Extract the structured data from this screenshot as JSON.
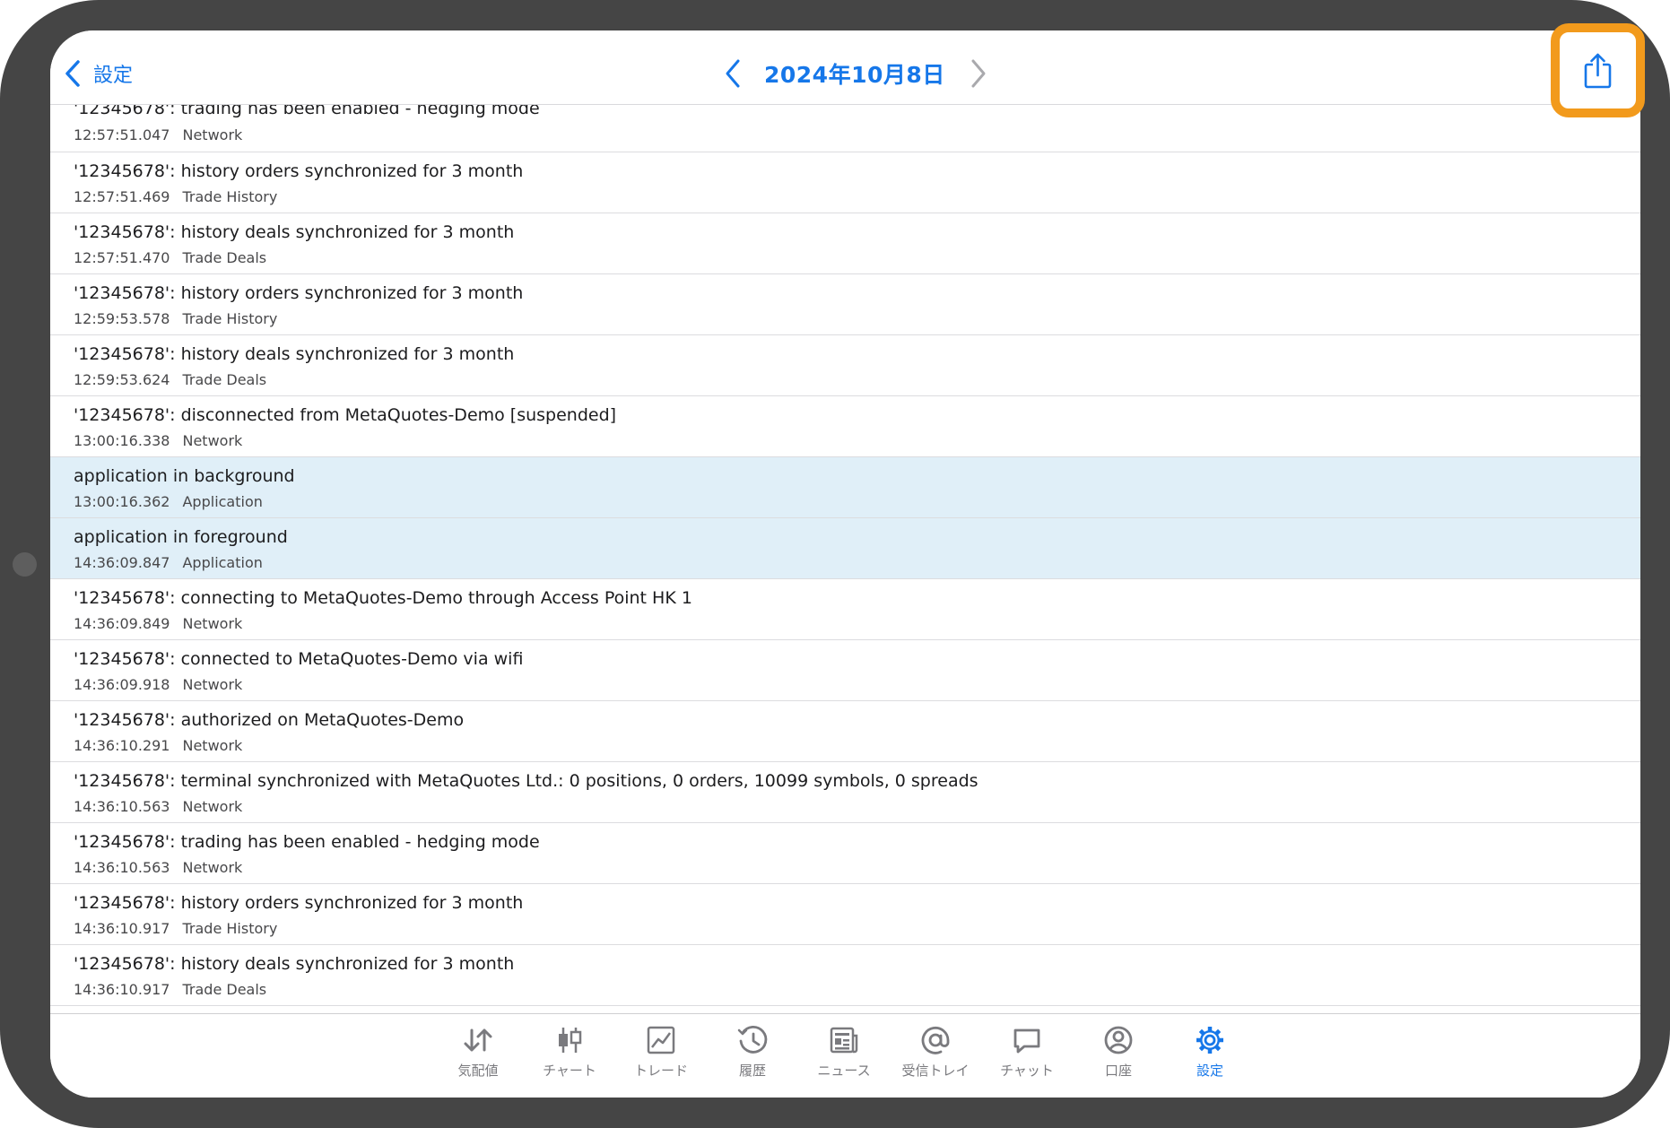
{
  "nav": {
    "back_label": "設定",
    "date_title": "2024年10月8日"
  },
  "colors": {
    "accent": "#1677e9",
    "highlight_box": "#f29a1c",
    "selected_row_bg": "#e0eff8",
    "device_frame": "#454545"
  },
  "logs": [
    {
      "msg": "'12345678': trading has been enabled - hedging mode",
      "time": "12:57:51.047",
      "category": "Network"
    },
    {
      "msg": "'12345678': history orders synchronized for 3 month",
      "time": "12:57:51.469",
      "category": "Trade History"
    },
    {
      "msg": "'12345678': history deals synchronized for 3 month",
      "time": "12:57:51.470",
      "category": "Trade Deals"
    },
    {
      "msg": "'12345678': history orders synchronized for 3 month",
      "time": "12:59:53.578",
      "category": "Trade History"
    },
    {
      "msg": "'12345678': history deals synchronized for 3 month",
      "time": "12:59:53.624",
      "category": "Trade Deals"
    },
    {
      "msg": "'12345678': disconnected from MetaQuotes-Demo [suspended]",
      "time": "13:00:16.338",
      "category": "Network"
    },
    {
      "msg": "application in background",
      "time": "13:00:16.362",
      "category": "Application"
    },
    {
      "msg": "application in foreground",
      "time": "14:36:09.847",
      "category": "Application"
    },
    {
      "msg": "'12345678': connecting to MetaQuotes-Demo through Access Point HK 1",
      "time": "14:36:09.849",
      "category": "Network"
    },
    {
      "msg": "'12345678': connected to MetaQuotes-Demo via wifi",
      "time": "14:36:09.918",
      "category": "Network"
    },
    {
      "msg": "'12345678': authorized on MetaQuotes-Demo",
      "time": "14:36:10.291",
      "category": "Network"
    },
    {
      "msg": "'12345678': terminal synchronized with MetaQuotes Ltd.: 0 positions, 0 orders, 10099 symbols, 0 spreads",
      "time": "14:36:10.563",
      "category": "Network"
    },
    {
      "msg": "'12345678': trading has been enabled - hedging mode",
      "time": "14:36:10.563",
      "category": "Network"
    },
    {
      "msg": "'12345678': history orders synchronized for 3 month",
      "time": "14:36:10.917",
      "category": "Trade History"
    },
    {
      "msg": "'12345678': history deals synchronized for 3 month",
      "time": "14:36:10.917",
      "category": "Trade Deals"
    }
  ],
  "tabs": [
    {
      "label": "気配値",
      "icon": "quotes-arrows-icon"
    },
    {
      "label": "チャート",
      "icon": "candlestick-chart-icon"
    },
    {
      "label": "トレード",
      "icon": "trade-line-chart-icon"
    },
    {
      "label": "履歴",
      "icon": "history-clock-icon"
    },
    {
      "label": "ニュース",
      "icon": "news-icon"
    },
    {
      "label": "受信トレイ",
      "icon": "at-mail-icon"
    },
    {
      "label": "チャット",
      "icon": "chat-bubble-icon"
    },
    {
      "label": "口座",
      "icon": "account-person-icon"
    },
    {
      "label": "設定",
      "icon": "settings-gear-icon"
    }
  ]
}
